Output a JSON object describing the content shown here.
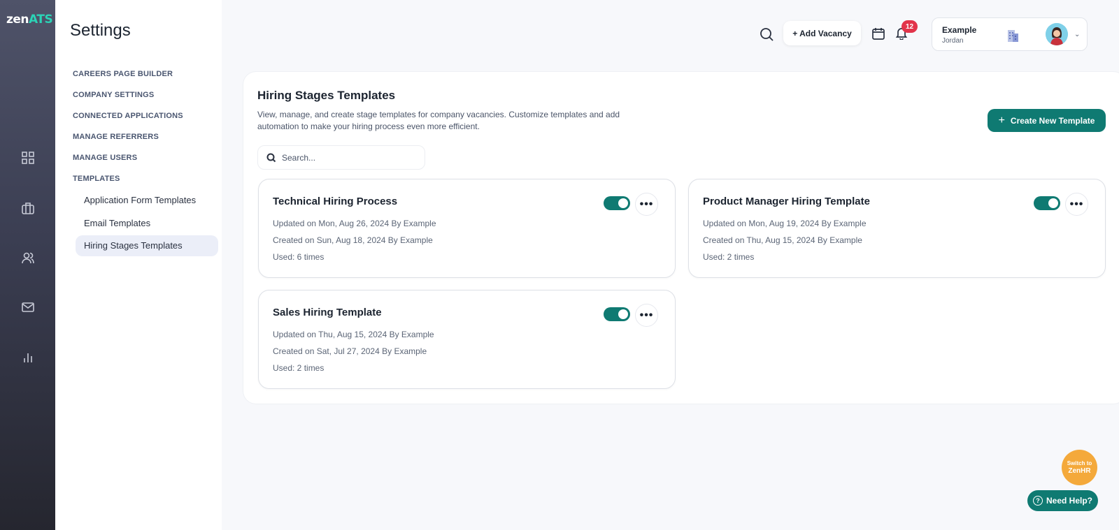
{
  "app": {
    "logo_prefix": "zen",
    "logo_suffix": "ATS"
  },
  "rail": {
    "icons": [
      "dashboard-icon",
      "briefcase-icon",
      "users-icon",
      "mail-icon",
      "reports-icon"
    ]
  },
  "settings": {
    "title": "Settings",
    "nav": [
      "CAREERS PAGE BUILDER",
      "COMPANY SETTINGS",
      "CONNECTED APPLICATIONS",
      "MANAGE REFERRERS",
      "MANAGE USERS",
      "TEMPLATES"
    ],
    "sub_items": [
      "Application Form Templates",
      "Email Templates",
      "Hiring Stages Templates"
    ],
    "active_sub_item": "Hiring Stages Templates"
  },
  "topbar": {
    "add_vacancy_label": "+ Add Vacancy",
    "notification_count": "12",
    "account_name": "Example",
    "account_user": "Jordan"
  },
  "main": {
    "title": "Hiring Stages Templates",
    "description": "View, manage, and create stage templates for company vacancies. Customize templates and add automation to make your hiring process even more efficient.",
    "create_label": "Create New Template",
    "search_placeholder": "Search...",
    "templates": [
      {
        "name": "Technical Hiring Process",
        "updated": "Updated on Mon, Aug 26, 2024 By Example",
        "created": "Created on Sun, Aug 18, 2024 By Example",
        "used": "Used: 6 times",
        "enabled": true
      },
      {
        "name": "Product Manager Hiring Template",
        "updated": "Updated on Mon, Aug 19, 2024 By Example",
        "created": "Created on Thu, Aug 15, 2024 By Example",
        "used": "Used: 2 times",
        "enabled": true
      },
      {
        "name": "Sales Hiring Template",
        "updated": "Updated on Thu, Aug 15, 2024 By Example",
        "created": "Created on Sat, Jul 27, 2024 By Example",
        "used": "Used: 2 times",
        "enabled": true
      }
    ]
  },
  "floating": {
    "switch_line1": "Switch to",
    "switch_line2": "ZenHR",
    "help_label": "Need Help?"
  }
}
